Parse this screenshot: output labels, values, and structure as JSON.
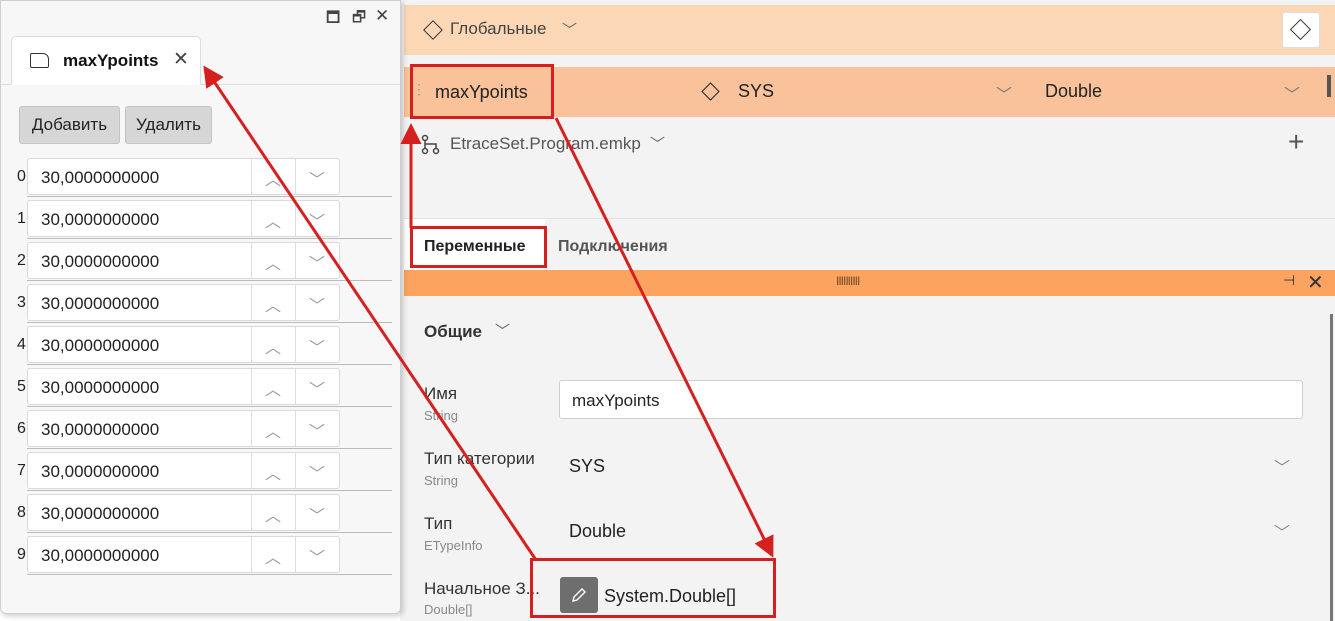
{
  "window": {
    "maximize_glyph": "🗖",
    "restore_glyph": "🗗",
    "close_glyph": "✕"
  },
  "doc_tab": {
    "title": "maxYpoints",
    "close_glyph": "✕"
  },
  "array_editor": {
    "add_label": "Добавить",
    "delete_label": "Удалить",
    "items": [
      {
        "index": "0",
        "value": "30,0000000000"
      },
      {
        "index": "1",
        "value": "30,0000000000"
      },
      {
        "index": "2",
        "value": "30,0000000000"
      },
      {
        "index": "3",
        "value": "30,0000000000"
      },
      {
        "index": "4",
        "value": "30,0000000000"
      },
      {
        "index": "5",
        "value": "30,0000000000"
      },
      {
        "index": "6",
        "value": "30,0000000000"
      },
      {
        "index": "7",
        "value": "30,0000000000"
      },
      {
        "index": "8",
        "value": "30,0000000000"
      },
      {
        "index": "9",
        "value": "30,0000000000"
      }
    ]
  },
  "globals_bar": {
    "label": "Глобальные",
    "chevron": "﹀"
  },
  "variable_row": {
    "name": "maxYpoints",
    "category": "SYS",
    "type": "Double",
    "chevron": "﹀",
    "grip": "⋮"
  },
  "program_row": {
    "label": "EtraceSet.Program.emkp",
    "chevron": "﹀",
    "plus": "+"
  },
  "tabs": {
    "variables": "Переменные",
    "connections": "Подключения"
  },
  "panel_bar": {
    "grip": "IIIIIIIIII",
    "pin": "⊣",
    "close": "✕"
  },
  "properties": {
    "section_title": "Общие",
    "chevron": "﹀",
    "name_label": "Имя",
    "name_type": "String",
    "name_value": "maxYpoints",
    "category_label": "Тип категории",
    "category_type": "String",
    "category_value": "SYS",
    "type_label": "Тип",
    "type_type": "ETypeInfo",
    "type_value": "Double",
    "initial_label": "Начальное З...",
    "initial_type": "Double[]",
    "initial_value": "System.Double[]"
  },
  "colors": {
    "annotation_red": "#d62020",
    "globals_bar_bg": "#fbd7b5",
    "selected_row_bg": "#f9c29b",
    "panel_bar_bg": "#fba35f"
  }
}
